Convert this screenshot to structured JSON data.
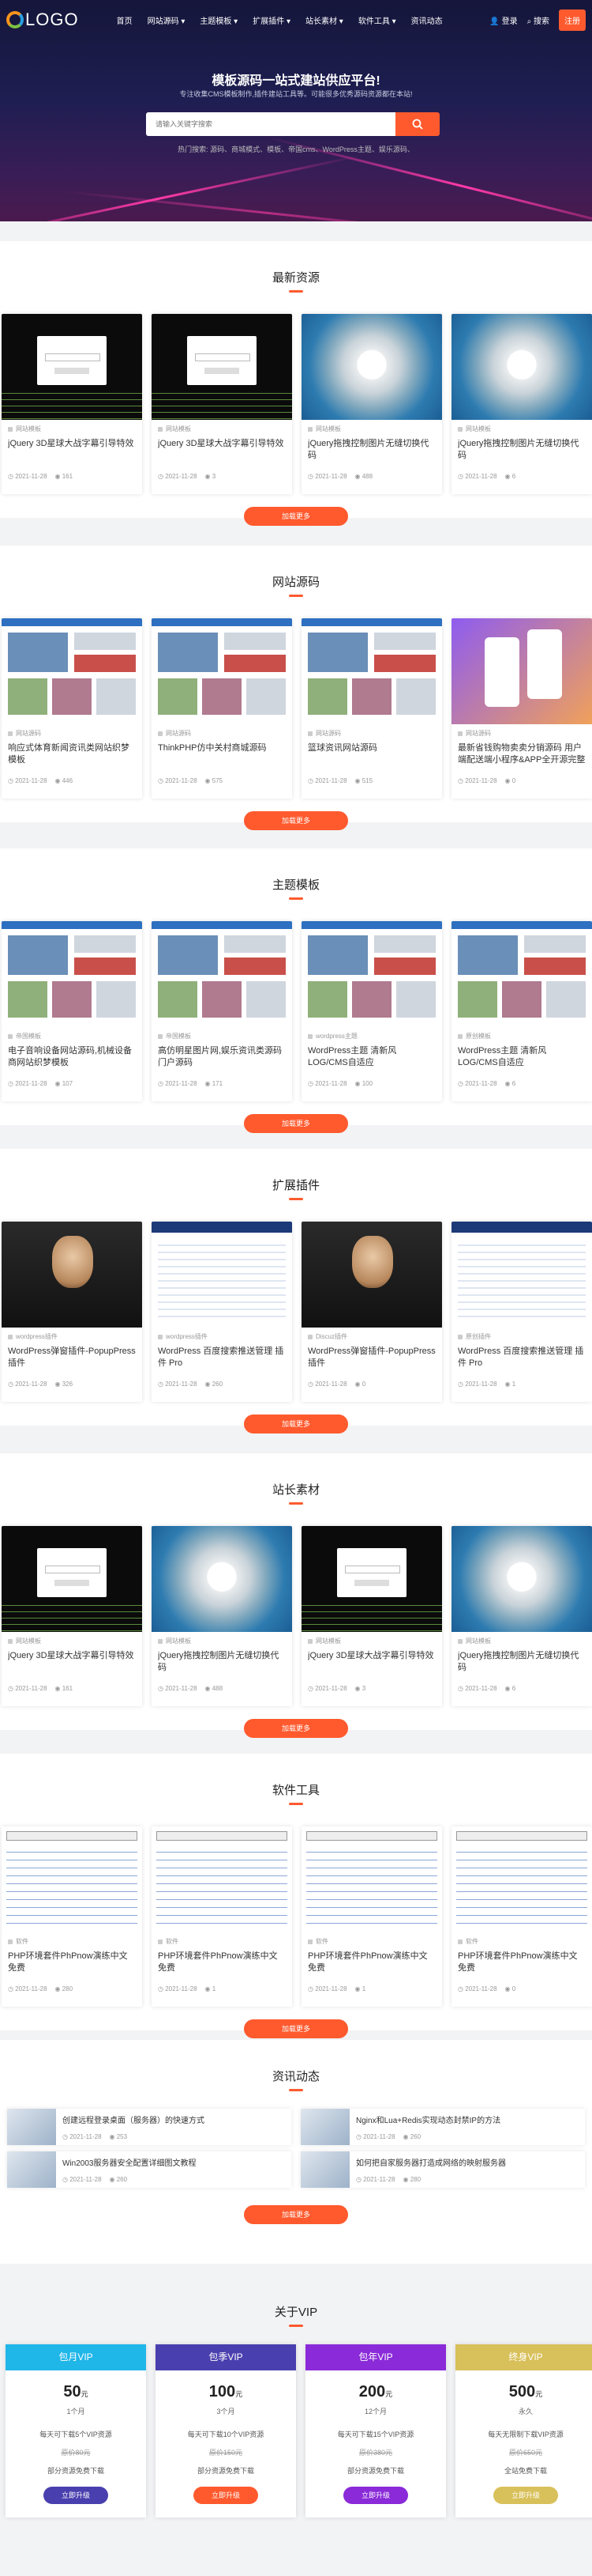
{
  "header": {
    "logo_text": "LOGO",
    "nav": [
      "首页",
      "网站源码 ▾",
      "主题模板 ▾",
      "扩展插件 ▾",
      "站长素材 ▾",
      "软件工具 ▾",
      "资讯动态"
    ],
    "signin": "登录",
    "search": "搜索",
    "register": "注册"
  },
  "hero": {
    "title": "模板源码一站式建站供应平台!",
    "subtitle": "专注收集CMS模板制作,插件建站工具等。可能很多优秀源码资源都在本站!",
    "placeholder": "请输入关键字搜索",
    "hot": "热门搜索: 源码、商城模式、模板、帝国cms、WordPress主题、娱乐源码、"
  },
  "common": {
    "more": "加载更多"
  },
  "sections": [
    {
      "title": "最新资源",
      "cards": [
        {
          "cat": "网站模板",
          "title": "jQuery 3D星球大战字幕引导特效",
          "date": "2021-11-28",
          "views": "161",
          "thumb": "dark"
        },
        {
          "cat": "网站模板",
          "title": "jQuery 3D星球大战字幕引导特效",
          "date": "2021-11-28",
          "views": "3",
          "thumb": "dark"
        },
        {
          "cat": "网站模板",
          "title": "jQuery拖拽控制图片无缝切换代码",
          "date": "2021-11-28",
          "views": "488",
          "thumb": "flower"
        },
        {
          "cat": "网站模板",
          "title": "jQuery拖拽控制图片无缝切换代码",
          "date": "2021-11-28",
          "views": "6",
          "thumb": "flower"
        }
      ]
    },
    {
      "title": "网站源码",
      "cards": [
        {
          "cat": "网站源码",
          "title": "响应式体育新闻资讯类网站织梦模板",
          "date": "2021-11-28",
          "views": "446",
          "thumb": "site"
        },
        {
          "cat": "网站源码",
          "title": "ThinkPHP仿中关村商城源码",
          "date": "2021-11-28",
          "views": "575",
          "thumb": "site"
        },
        {
          "cat": "网站源码",
          "title": "篮球资讯网站源码",
          "date": "2021-11-28",
          "views": "515",
          "thumb": "site"
        },
        {
          "cat": "网站源码",
          "title": "最新省钱购物卖卖分销源码 用户端配送端小程序&APP全开源完整版",
          "date": "2021-11-28",
          "views": "0",
          "thumb": "purple"
        }
      ]
    },
    {
      "title": "主题模板",
      "cards": [
        {
          "cat": "帝国模板",
          "title": "电子音响设备网站源码,机械设备商网站织梦模板",
          "date": "2021-11-28",
          "views": "107",
          "thumb": "site"
        },
        {
          "cat": "帝国模板",
          "title": "高仿明星图片网,娱乐资讯类源码门户源码",
          "date": "2021-11-28",
          "views": "171",
          "thumb": "site"
        },
        {
          "cat": "wordpress主题",
          "title": "WordPress主题 清新风LOG/CMS自适应",
          "date": "2021-11-28",
          "views": "100",
          "thumb": "site"
        },
        {
          "cat": "原创模板",
          "title": "WordPress主题 清新风LOG/CMS自适应",
          "date": "2021-11-28",
          "views": "6",
          "thumb": "site"
        }
      ]
    },
    {
      "title": "扩展插件",
      "cards": [
        {
          "cat": "wordpress插件",
          "title": "WordPress弹窗插件-PopupPress插件",
          "date": "2021-11-28",
          "views": "326",
          "thumb": "photo"
        },
        {
          "cat": "wordpress插件",
          "title": "WordPress 百度搜索推送管理 插件 Pro",
          "date": "2021-11-28",
          "views": "260",
          "thumb": "blue"
        },
        {
          "cat": "Discuz插件",
          "title": "WordPress弹窗插件-PopupPress插件",
          "date": "2021-11-28",
          "views": "0",
          "thumb": "photo"
        },
        {
          "cat": "原创插件",
          "title": "WordPress 百度搜索推送管理 插件 Pro",
          "date": "2021-11-28",
          "views": "1",
          "thumb": "blue"
        }
      ]
    },
    {
      "title": "站长素材",
      "cards": [
        {
          "cat": "网站模板",
          "title": "jQuery 3D星球大战字幕引导特效",
          "date": "2021-11-28",
          "views": "161",
          "thumb": "dark"
        },
        {
          "cat": "网站模板",
          "title": "jQuery拖拽控制图片无缝切换代码",
          "date": "2021-11-28",
          "views": "488",
          "thumb": "flower"
        },
        {
          "cat": "网站模板",
          "title": "jQuery 3D星球大战字幕引导特效",
          "date": "2021-11-28",
          "views": "3",
          "thumb": "dark"
        },
        {
          "cat": "网站模板",
          "title": "jQuery拖拽控制图片无缝切换代码",
          "date": "2021-11-28",
          "views": "6",
          "thumb": "flower"
        }
      ]
    },
    {
      "title": "软件工具",
      "cards": [
        {
          "cat": "软件",
          "title": "PHP环境套件PhPnow演练中文免费",
          "date": "2021-11-28",
          "views": "280",
          "thumb": "tbl"
        },
        {
          "cat": "软件",
          "title": "PHP环境套件PhPnow演练中文免费",
          "date": "2021-11-28",
          "views": "1",
          "thumb": "tbl"
        },
        {
          "cat": "软件",
          "title": "PHP环境套件PhPnow演练中文免费",
          "date": "2021-11-28",
          "views": "1",
          "thumb": "tbl"
        },
        {
          "cat": "软件",
          "title": "PHP环境套件PhPnow演练中文免费",
          "date": "2021-11-28",
          "views": "0",
          "thumb": "tbl"
        }
      ]
    }
  ],
  "news": {
    "title": "资讯动态",
    "items": [
      {
        "title": "创建远程登录桌面（服务器）的快速方式",
        "date": "2021-11-28",
        "views": "253"
      },
      {
        "title": "Nginx和Lua+Redis实现动态封禁IP的方法",
        "date": "2021-11-28",
        "views": "260"
      },
      {
        "title": "Win2003服务器安全配置详细图文教程",
        "date": "2021-11-28",
        "views": "260"
      },
      {
        "title": "如何把自家服务器打造成网络的映射服务器",
        "date": "2021-11-28",
        "views": "280"
      }
    ]
  },
  "vip": {
    "title": "关于VIP",
    "plans": [
      {
        "name": "包月VIP",
        "price": "50",
        "unit": "元",
        "days": "1个月",
        "line1": "每天可下载5个VIP资源",
        "line2": "原价80元",
        "line3": "部分资源免费下载",
        "btn": "立即升级",
        "color": "#1fb6e8",
        "btncolor": "#4a3fae"
      },
      {
        "name": "包季VIP",
        "price": "100",
        "unit": "元",
        "days": "3个月",
        "line1": "每天可下载10个VIP资源",
        "line2": "原价150元",
        "line3": "部分资源免费下载",
        "btn": "立即升级",
        "color": "#4a3fae",
        "btncolor": "#ff5a2e"
      },
      {
        "name": "包年VIP",
        "price": "200",
        "unit": "元",
        "days": "12个月",
        "line1": "每天可下载15个VIP资源",
        "line2": "原价380元",
        "line3": "部分资源免费下载",
        "btn": "立即升级",
        "color": "#8a2ad8",
        "btncolor": "#8a2ad8"
      },
      {
        "name": "终身VIP",
        "price": "500",
        "unit": "元",
        "days": "永久",
        "line1": "每天无限制下载VIP资源",
        "line2": "原价650元",
        "line3": "全站免费下载",
        "btn": "立即升级",
        "color": "#d8c05a",
        "btncolor": "#d8c05a"
      }
    ]
  }
}
